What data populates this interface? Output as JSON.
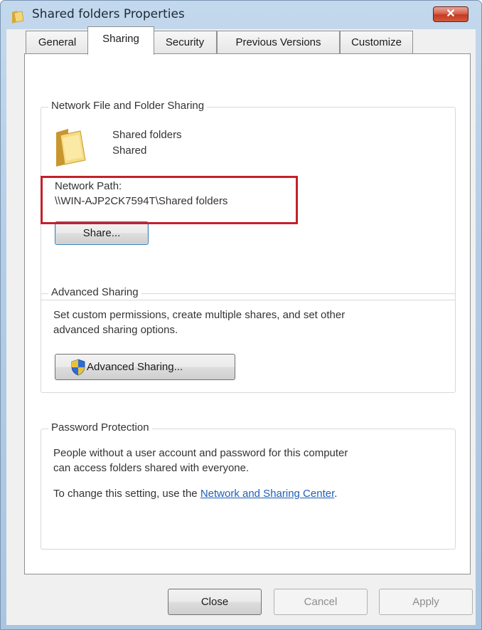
{
  "window": {
    "title": "Shared folders Properties",
    "close_glyph": "✕",
    "title_icon": "folder-icon"
  },
  "tabs": [
    {
      "label": "General",
      "active": false
    },
    {
      "label": "Sharing",
      "active": true
    },
    {
      "label": "Security",
      "active": false
    },
    {
      "label": "Previous Versions",
      "active": false
    },
    {
      "label": "Customize",
      "active": false
    }
  ],
  "network_sharing": {
    "legend": "Network File and Folder Sharing",
    "folder_icon": "folder-icon",
    "folder_name": "Shared folders",
    "status": "Shared",
    "path_label": "Network Path:",
    "path_value": "\\\\WIN-AJP2CK7594T\\Shared folders",
    "share_button": "Share..."
  },
  "advanced_sharing": {
    "legend": "Advanced Sharing",
    "description_line1": "Set custom permissions, create multiple shares, and set other",
    "description_line2": "advanced sharing options.",
    "button_icon": "uac-shield-icon",
    "button_label": "Advanced Sharing..."
  },
  "password_protection": {
    "legend": "Password Protection",
    "description_line1": "People without a user account and password for this computer",
    "description_line2": "can access folders shared with everyone.",
    "change_prefix": "To change this setting, use the ",
    "link_text": "Network and Sharing Center",
    "change_suffix": "."
  },
  "footer": {
    "close_label": "Close",
    "cancel_label": "Cancel",
    "apply_label": "Apply"
  },
  "colors": {
    "highlight_box": "#c4202b",
    "link": "#1f5fb8",
    "title_bar": "#b4cde6",
    "close_button": "#c23b21"
  }
}
